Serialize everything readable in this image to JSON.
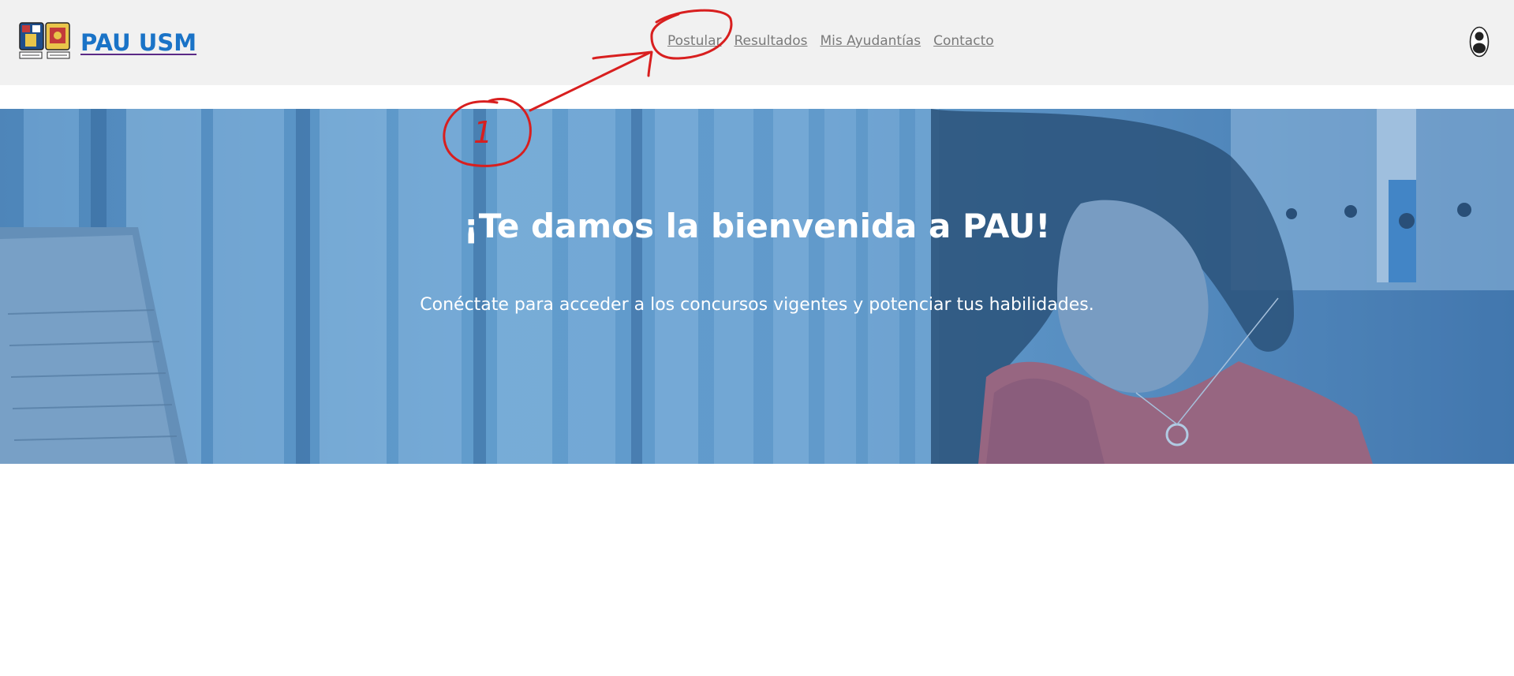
{
  "header": {
    "brand_title": "PAU USM",
    "crest_icon": "university-crest-icon",
    "nav": [
      {
        "label": "Postular"
      },
      {
        "label": "Resultados"
      },
      {
        "label": "Mis Ayudantías"
      },
      {
        "label": "Contacto"
      }
    ],
    "user_icon": "user-avatar-icon"
  },
  "hero": {
    "title": "¡Te damos la bienvenida a PAU!",
    "subtitle": "Conéctate para acceder a los concursos vigentes y potenciar tus habilidades.",
    "background": "photo-woman-at-laptop-blue-overlay"
  },
  "annotation": {
    "step_label": "1",
    "color": "#d81f1f"
  },
  "colors": {
    "brand": "#1a73c7",
    "header_bg": "#f1f1f1",
    "nav_link": "#7a7a7a",
    "hero_overlay": "#5b95c6"
  }
}
